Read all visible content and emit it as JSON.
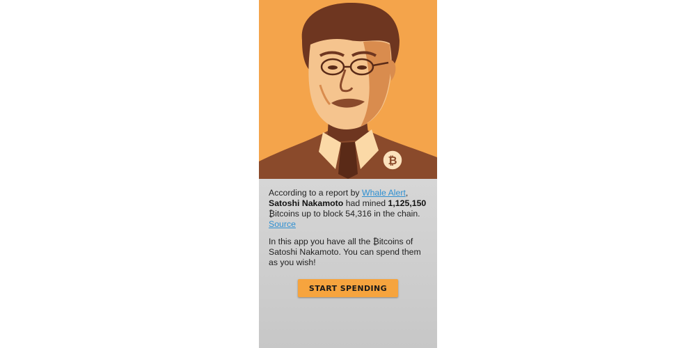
{
  "colors": {
    "portrait_background": "#f4a44b",
    "portrait_dark": "#8a4a2b",
    "link": "#2e8fd1",
    "button": "#f6a43e"
  },
  "portrait": {
    "icon": "bitcoin-badge-icon",
    "badge_symbol": "₿"
  },
  "intro": {
    "prefix": "According to a report by ",
    "source_name": "Whale Alert",
    "comma": ",",
    "person": "Satoshi Nakamoto",
    "mined_text": " had mined ",
    "amount": "1,125,150",
    "suffix": "₿itcoins up to block 54,316 in the chain.",
    "source_link": "Source"
  },
  "description": "In this app you have all the ₿itcoins of Satoshi Nakamoto. You can spend them as you wish!",
  "cta": {
    "label": "START SPENDING"
  }
}
